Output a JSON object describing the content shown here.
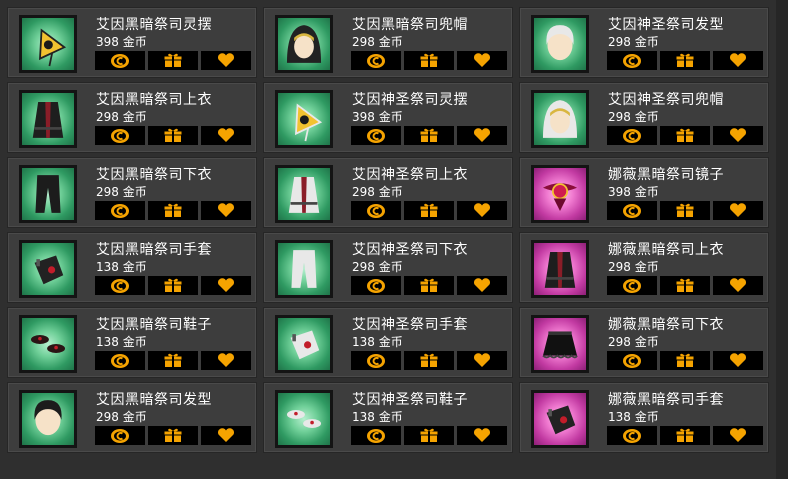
{
  "items": [
    {
      "name": "艾因黑暗祭司灵摆",
      "price": "398 金币",
      "bg": "green",
      "icon": "pendulum-icon"
    },
    {
      "name": "艾因黑暗祭司兜帽",
      "price": "298 金币",
      "bg": "green",
      "icon": "hood-icon"
    },
    {
      "name": "艾因神圣祭司发型",
      "price": "298 金币",
      "bg": "green",
      "icon": "hairstyle-icon"
    },
    {
      "name": "艾因黑暗祭司上衣",
      "price": "298 金币",
      "bg": "green",
      "icon": "coat-icon"
    },
    {
      "name": "艾因神圣祭司灵摆",
      "price": "398 金币",
      "bg": "green",
      "icon": "pendulum-icon"
    },
    {
      "name": "艾因神圣祭司兜帽",
      "price": "298 金币",
      "bg": "green",
      "icon": "hood-icon"
    },
    {
      "name": "艾因黑暗祭司下衣",
      "price": "298 金币",
      "bg": "green",
      "icon": "pants-icon"
    },
    {
      "name": "艾因神圣祭司上衣",
      "price": "298 金币",
      "bg": "green",
      "icon": "coat-icon"
    },
    {
      "name": "娜薇黑暗祭司镜子",
      "price": "398 金币",
      "bg": "pink",
      "icon": "mirror-icon"
    },
    {
      "name": "艾因黑暗祭司手套",
      "price": "138 金币",
      "bg": "green",
      "icon": "glove-icon"
    },
    {
      "name": "艾因神圣祭司下衣",
      "price": "298 金币",
      "bg": "green",
      "icon": "pants-icon"
    },
    {
      "name": "娜薇黑暗祭司上衣",
      "price": "298 金币",
      "bg": "pink",
      "icon": "coat-icon"
    },
    {
      "name": "艾因黑暗祭司鞋子",
      "price": "138 金币",
      "bg": "green",
      "icon": "shoes-icon"
    },
    {
      "name": "艾因神圣祭司手套",
      "price": "138 金币",
      "bg": "green",
      "icon": "glove-icon"
    },
    {
      "name": "娜薇黑暗祭司下衣",
      "price": "298 金币",
      "bg": "pink",
      "icon": "skirt-icon"
    },
    {
      "name": "艾因黑暗祭司发型",
      "price": "298 金币",
      "bg": "green",
      "icon": "hairstyle-icon"
    },
    {
      "name": "艾因神圣祭司鞋子",
      "price": "138 金币",
      "bg": "green",
      "icon": "shoes-icon"
    },
    {
      "name": "娜薇黑暗祭司手套",
      "price": "138 金币",
      "bg": "pink",
      "icon": "glove-icon"
    }
  ],
  "buttons": {
    "buy_icon": "gold-coin-icon",
    "gift_icon": "gift-box-icon",
    "wish_icon": "heart-icon"
  },
  "colors": {
    "button_icon": "#f5a300",
    "panel": "#3d3d3d",
    "background": "#2f2f2f"
  }
}
